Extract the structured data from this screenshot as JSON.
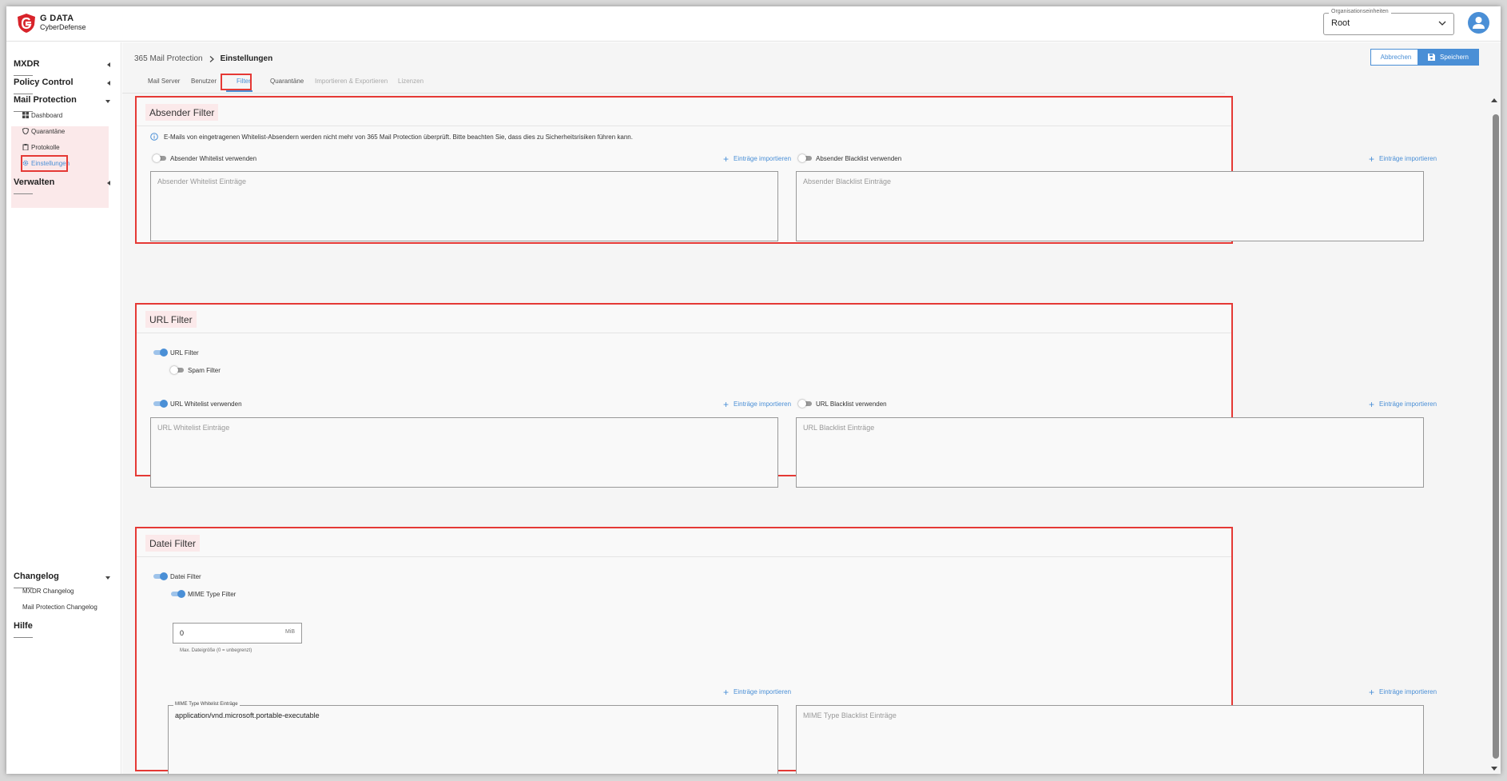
{
  "brand": {
    "name": "G DATA",
    "sub": "CyberDefense"
  },
  "org_select": {
    "label": "Organisationseinheiten",
    "value": "Root"
  },
  "sidebar": {
    "groups": [
      {
        "label": "MXDR"
      },
      {
        "label": "Policy Control"
      },
      {
        "label": "Mail Protection",
        "items": [
          "Dashboard",
          "Quarantäne",
          "Protokolle",
          "Einstellungen"
        ]
      },
      {
        "label": "Verwalten"
      }
    ],
    "changelog": {
      "label": "Changelog",
      "items": [
        "MXDR Changelog",
        "Mail Protection Changelog"
      ]
    },
    "help": "Hilfe"
  },
  "breadcrumb": {
    "parent": "365 Mail Protection",
    "current": "Einstellungen"
  },
  "actions": {
    "cancel": "Abbrechen",
    "save": "Speichern"
  },
  "tabs": [
    {
      "label": "Mail Server",
      "state": "normal"
    },
    {
      "label": "Benutzer",
      "state": "normal"
    },
    {
      "label": "Filter",
      "state": "active"
    },
    {
      "label": "Quarantäne",
      "state": "normal"
    },
    {
      "label": "Importieren & Exportieren",
      "state": "disabled"
    },
    {
      "label": "Lizenzen",
      "state": "disabled"
    }
  ],
  "sender_filter": {
    "title": "Absender Filter",
    "info": "E-Mails von eingetragenen Whitelist-Absendern werden nicht mehr von 365 Mail Protection überprüft. Bitte beachten Sie, dass dies zu Sicherheitsrisiken führen kann.",
    "whitelist_toggle": {
      "label": "Absender Whitelist verwenden",
      "on": false
    },
    "blacklist_toggle": {
      "label": "Absender Blacklist verwenden",
      "on": false
    },
    "import_label": "Einträge importieren",
    "whitelist_placeholder": "Absender Whitelist Einträge",
    "blacklist_placeholder": "Absender Blacklist Einträge"
  },
  "url_filter": {
    "title": "URL Filter",
    "url_toggle": {
      "label": "URL Filter",
      "on": true
    },
    "spam_toggle": {
      "label": "Spam Filter",
      "on": false
    },
    "whitelist_toggle": {
      "label": "URL Whitelist verwenden",
      "on": true
    },
    "blacklist_toggle": {
      "label": "URL Blacklist verwenden",
      "on": false
    },
    "import_label": "Einträge importieren",
    "whitelist_placeholder": "URL Whitelist Einträge",
    "blacklist_placeholder": "URL Blacklist Einträge"
  },
  "file_filter": {
    "title": "Datei Filter",
    "file_toggle": {
      "label": "Datei Filter",
      "on": true
    },
    "mime_toggle": {
      "label": "MIME Type Filter",
      "on": true
    },
    "max_size": {
      "value": "0",
      "unit": "MiB",
      "hint": "Max. Dateigröße (0 = unbegrenzt)"
    },
    "import_label": "Einträge importieren",
    "mime_whitelist_label": "MIME Type Whitelist Einträge",
    "mime_whitelist_value": "application/vnd.microsoft.portable-executable",
    "mime_blacklist_placeholder": "MIME Type Blacklist Einträge"
  },
  "colors": {
    "accent": "#4a8fd6",
    "highlight": "#e53935",
    "brand_red": "#d8232a"
  }
}
